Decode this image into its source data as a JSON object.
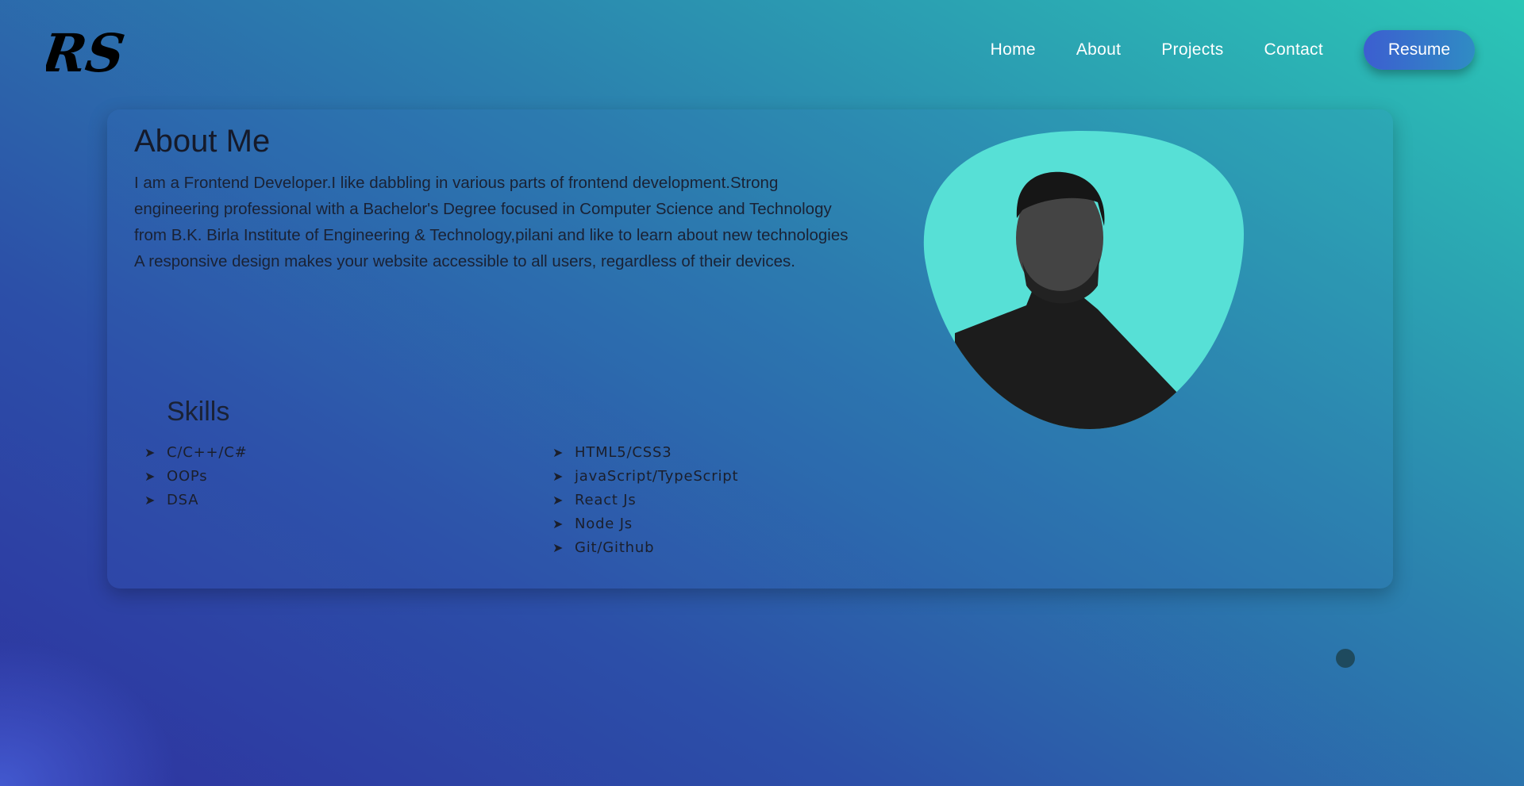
{
  "logo": {
    "text": "RS"
  },
  "nav": {
    "items": [
      "Home",
      "About",
      "Projects",
      "Contact"
    ],
    "resume": "Resume"
  },
  "about": {
    "title": "About Me",
    "paragraph": "I am a Frontend Developer.I like dabbling in various parts of frontend development.Strong engineering professional with a Bachelor's Degree focused in Computer Science and Technology from B.K. Birla Institute of Engineering & Technology,pilani and like to learn about new technologies A responsive design makes your website accessible to all users, regardless of their devices."
  },
  "skills": {
    "title": "Skills",
    "column1": [
      "C/C++/C#",
      "OOPs",
      "DSA"
    ],
    "column2": [
      "HTML5/CSS3",
      "javaScript/TypeScript",
      "React Js",
      "Node Js",
      "Git/Github"
    ]
  },
  "colors": {
    "blob": "#57e0d6",
    "gradient_start": "#2e33a0",
    "gradient_end": "#2bc6b6"
  }
}
